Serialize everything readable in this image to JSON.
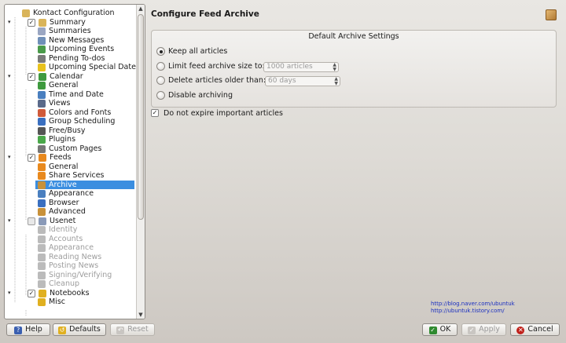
{
  "tree": {
    "items": [
      {
        "label": "Kontact Configuration",
        "level": 0,
        "icon": "folder-icon",
        "color": "#d9b45a",
        "expander": "",
        "checkbox": null,
        "disabled": false,
        "selected": false
      },
      {
        "label": "Summary",
        "level": 1,
        "icon": "summary-folder-icon",
        "color": "#d9b45a",
        "expander": "▾",
        "checkbox": true,
        "disabled": false,
        "selected": false
      },
      {
        "label": "Summaries",
        "level": 2,
        "icon": "summaries-icon",
        "color": "#9aa6c2",
        "expander": "",
        "checkbox": null,
        "disabled": false,
        "selected": false
      },
      {
        "label": "New Messages",
        "level": 2,
        "icon": "new-messages-icon",
        "color": "#6f8fb8",
        "expander": "",
        "checkbox": null,
        "disabled": false,
        "selected": false
      },
      {
        "label": "Upcoming Events",
        "level": 2,
        "icon": "calendar-icon",
        "color": "#4a9a4a",
        "expander": "",
        "checkbox": null,
        "disabled": false,
        "selected": false
      },
      {
        "label": "Pending To-dos",
        "level": 2,
        "icon": "todo-icon",
        "color": "#7a7a7a",
        "expander": "",
        "checkbox": null,
        "disabled": false,
        "selected": false
      },
      {
        "label": "Upcoming Special Dates",
        "level": 2,
        "icon": "star-icon",
        "color": "#e8c21e",
        "expander": "",
        "checkbox": null,
        "disabled": false,
        "selected": false
      },
      {
        "label": "Calendar",
        "level": 1,
        "icon": "calendar-icon",
        "color": "#3f9a3f",
        "expander": "▾",
        "checkbox": true,
        "disabled": false,
        "selected": false
      },
      {
        "label": "General",
        "level": 2,
        "icon": "calendar-general-icon",
        "color": "#3f9a3f",
        "expander": "",
        "checkbox": null,
        "disabled": false,
        "selected": false
      },
      {
        "label": "Time and Date",
        "level": 2,
        "icon": "clock-icon",
        "color": "#4a7fbf",
        "expander": "",
        "checkbox": null,
        "disabled": false,
        "selected": false
      },
      {
        "label": "Views",
        "level": 2,
        "icon": "views-icon",
        "color": "#5a6a8a",
        "expander": "",
        "checkbox": null,
        "disabled": false,
        "selected": false
      },
      {
        "label": "Colors and Fonts",
        "level": 2,
        "icon": "palette-icon",
        "color": "#d05a3a",
        "expander": "",
        "checkbox": null,
        "disabled": false,
        "selected": false
      },
      {
        "label": "Group Scheduling",
        "level": 2,
        "icon": "globe-icon",
        "color": "#3a6fc0",
        "expander": "",
        "checkbox": null,
        "disabled": false,
        "selected": false
      },
      {
        "label": "Free/Busy",
        "level": 2,
        "icon": "free-busy-icon",
        "color": "#555555",
        "expander": "",
        "checkbox": null,
        "disabled": false,
        "selected": false
      },
      {
        "label": "Plugins",
        "level": 2,
        "icon": "puzzle-icon",
        "color": "#4aa84a",
        "expander": "",
        "checkbox": null,
        "disabled": false,
        "selected": false
      },
      {
        "label": "Custom Pages",
        "level": 2,
        "icon": "custom-pages-icon",
        "color": "#777777",
        "expander": "",
        "checkbox": null,
        "disabled": false,
        "selected": false
      },
      {
        "label": "Feeds",
        "level": 1,
        "icon": "feeds-icon",
        "color": "#e8891e",
        "expander": "▾",
        "checkbox": true,
        "disabled": false,
        "selected": false
      },
      {
        "label": "General",
        "level": 2,
        "icon": "feeds-general-icon",
        "color": "#e8891e",
        "expander": "",
        "checkbox": null,
        "disabled": false,
        "selected": false
      },
      {
        "label": "Share Services",
        "level": 2,
        "icon": "share-icon",
        "color": "#e8891e",
        "expander": "",
        "checkbox": null,
        "disabled": false,
        "selected": false
      },
      {
        "label": "Archive",
        "level": 2,
        "icon": "archive-icon",
        "color": "#c8913a",
        "expander": "",
        "checkbox": null,
        "disabled": false,
        "selected": true
      },
      {
        "label": "Appearance",
        "level": 2,
        "icon": "appearance-icon",
        "color": "#4a7fbf",
        "expander": "",
        "checkbox": null,
        "disabled": false,
        "selected": false
      },
      {
        "label": "Browser",
        "level": 2,
        "icon": "browser-globe-icon",
        "color": "#3a6fc0",
        "expander": "",
        "checkbox": null,
        "disabled": false,
        "selected": false
      },
      {
        "label": "Advanced",
        "level": 2,
        "icon": "advanced-icon",
        "color": "#c8913a",
        "expander": "",
        "checkbox": null,
        "disabled": false,
        "selected": false
      },
      {
        "label": "Usenet",
        "level": 1,
        "icon": "usenet-icon",
        "color": "#8a9ab8",
        "expander": "▾",
        "checkbox": false,
        "disabled": false,
        "selected": false
      },
      {
        "label": "Identity",
        "level": 2,
        "icon": "identity-icon",
        "color": "#bbbbbb",
        "expander": "",
        "checkbox": null,
        "disabled": true,
        "selected": false
      },
      {
        "label": "Accounts",
        "level": 2,
        "icon": "accounts-icon",
        "color": "#bbbbbb",
        "expander": "",
        "checkbox": null,
        "disabled": true,
        "selected": false
      },
      {
        "label": "Appearance",
        "level": 2,
        "icon": "usenet-appearance-icon",
        "color": "#bbbbbb",
        "expander": "",
        "checkbox": null,
        "disabled": true,
        "selected": false
      },
      {
        "label": "Reading News",
        "level": 2,
        "icon": "reading-news-icon",
        "color": "#bbbbbb",
        "expander": "",
        "checkbox": null,
        "disabled": true,
        "selected": false
      },
      {
        "label": "Posting News",
        "level": 2,
        "icon": "posting-news-icon",
        "color": "#bbbbbb",
        "expander": "",
        "checkbox": null,
        "disabled": true,
        "selected": false
      },
      {
        "label": "Signing/Verifying",
        "level": 2,
        "icon": "signing-icon",
        "color": "#bbbbbb",
        "expander": "",
        "checkbox": null,
        "disabled": true,
        "selected": false
      },
      {
        "label": "Cleanup",
        "level": 2,
        "icon": "cleanup-icon",
        "color": "#bbbbbb",
        "expander": "",
        "checkbox": null,
        "disabled": true,
        "selected": false
      },
      {
        "label": "Notebooks",
        "level": 1,
        "icon": "notebooks-icon",
        "color": "#e0b020",
        "expander": "▾",
        "checkbox": true,
        "disabled": false,
        "selected": false
      },
      {
        "label": "Misc",
        "level": 2,
        "icon": "misc-icon",
        "color": "#e0b020",
        "expander": "",
        "checkbox": null,
        "disabled": false,
        "selected": false
      }
    ]
  },
  "page": {
    "title": "Configure Feed Archive",
    "icon": "archive-box-icon"
  },
  "archive_settings": {
    "group_title": "Default Archive Settings",
    "options": [
      {
        "label": "Keep all articles",
        "checked": true
      },
      {
        "label": "Limit feed archive size to:",
        "checked": false,
        "field_value": "1000 articles"
      },
      {
        "label": "Delete articles older than:",
        "checked": false,
        "field_value": "60 days"
      },
      {
        "label": "Disable archiving",
        "checked": false
      }
    ]
  },
  "expire_checkbox": {
    "label": "Do not expire important articles",
    "checked": true
  },
  "watermark": {
    "line1": "http://blog.naver.com/ubuntuk",
    "line2": "http://ubuntuk.tistory.com/"
  },
  "buttons": {
    "help": "Help",
    "defaults": "Defaults",
    "reset": "Reset",
    "ok": "OK",
    "apply": "Apply",
    "cancel": "Cancel"
  },
  "colors": {
    "selection": "#3b8ee0",
    "ok_icon": "#2f8a2f",
    "cancel_icon": "#c0201a",
    "help_icon": "#3a5fb0"
  }
}
